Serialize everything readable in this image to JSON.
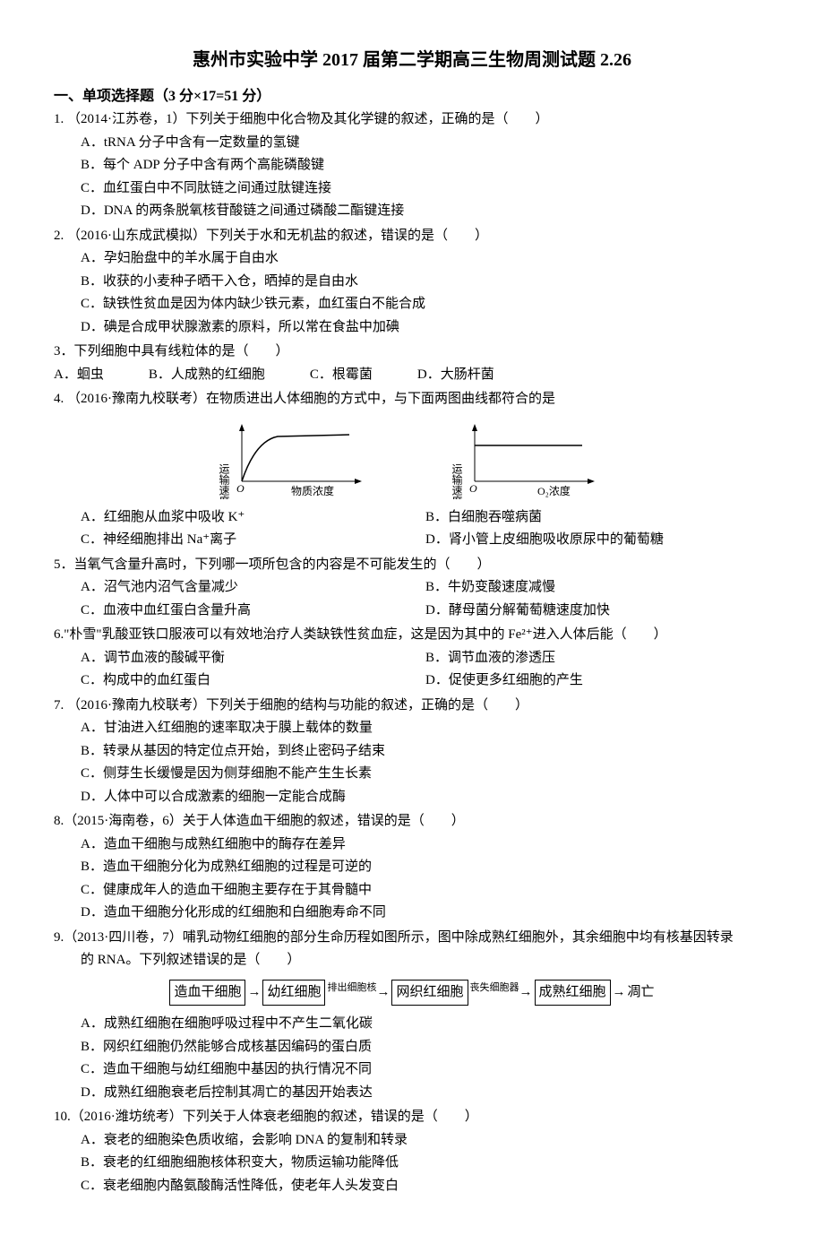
{
  "title": "惠州市实验中学 2017 届第二学期高三生物周测试题 2.26",
  "section1_header": "一、单项选择题（3 分×17=51 分）",
  "q1": {
    "stem": "1. （2014·江苏卷，1）下列关于细胞中化合物及其化学键的叙述，正确的是（　　）",
    "a": "A．tRNA 分子中含有一定数量的氢键",
    "b": "B．每个 ADP 分子中含有两个高能磷酸键",
    "c": "C．血红蛋白中不同肽链之间通过肽键连接",
    "d": "D．DNA 的两条脱氧核苷酸链之间通过磷酸二酯键连接"
  },
  "q2": {
    "stem": "2. （2016·山东成武模拟）下列关于水和无机盐的叙述，错误的是（　　）",
    "a": "A．孕妇胎盘中的羊水属于自由水",
    "b": "B．收获的小麦种子晒干入仓，晒掉的是自由水",
    "c": "C．缺铁性贫血是因为体内缺少铁元素，血红蛋白不能合成",
    "d": "D．碘是合成甲状腺激素的原料，所以常在食盐中加碘"
  },
  "q3": {
    "stem": "3．下列细胞中具有线粒体的是（　　）",
    "a": "A．蛔虫",
    "b": "B．人成熟的红细胞",
    "c": "C．根霉菌",
    "d": "D．大肠杆菌"
  },
  "q4": {
    "stem": "4. （2016·豫南九校联考）在物质进出人体细胞的方式中，与下面两图曲线都符合的是",
    "a": "A．红细胞从血浆中吸收 K⁺",
    "b": "B．白细胞吞噬病菌",
    "c": "C．神经细胞排出 Na⁺离子",
    "d": "D．肾小管上皮细胞吸收原尿中的葡萄糖"
  },
  "chart_data": [
    {
      "type": "line",
      "title": "",
      "xlabel": "物质浓度",
      "ylabel": "运输速度",
      "description": "saturation curve rising then plateau",
      "origin": "O"
    },
    {
      "type": "line",
      "title": "",
      "xlabel": "O₂浓度",
      "ylabel": "运输速度",
      "description": "horizontal line, constant rate independent of O2",
      "origin": "O"
    }
  ],
  "chart_labels": {
    "ylabel1": "运输速度",
    "xlabel1": "物质浓度",
    "origin1": "O",
    "ylabel2": "运输速度",
    "xlabel2": "O₂浓度",
    "origin2": "O"
  },
  "q5": {
    "stem": "5．当氧气含量升高时，下列哪一项所包含的内容是不可能发生的（　　）",
    "a": "A．沼气池内沼气含量减少",
    "b": "B．牛奶变酸速度减慢",
    "c": "C．血液中血红蛋白含量升高",
    "d": "D．酵母菌分解葡萄糖速度加快"
  },
  "q6": {
    "stem": "6.\"朴雪\"乳酸亚铁口服液可以有效地治疗人类缺铁性贫血症，这是因为其中的 Fe²⁺进入人体后能（　　）",
    "a": "A．调节血液的酸碱平衡",
    "b": "B．调节血液的渗透压",
    "c": "C．构成中的血红蛋白",
    "d": "D．促使更多红细胞的产生"
  },
  "q7": {
    "stem": "7. （2016·豫南九校联考）下列关于细胞的结构与功能的叙述，正确的是（　　）",
    "a": "A．甘油进入红细胞的速率取决于膜上载体的数量",
    "b": "B．转录从基因的特定位点开始，到终止密码子结束",
    "c": "C．侧芽生长缓慢是因为侧芽细胞不能产生生长素",
    "d": "D．人体中可以合成激素的细胞一定能合成酶"
  },
  "q8": {
    "stem": "8.（2015·海南卷，6）关于人体造血干细胞的叙述，错误的是（　　）",
    "a": "A．造血干细胞与成熟红细胞中的酶存在差异",
    "b": "B．造血干细胞分化为成熟红细胞的过程是可逆的",
    "c": "C．健康成年人的造血干细胞主要存在于其骨髓中",
    "d": "D．造血干细胞分化形成的红细胞和白细胞寿命不同"
  },
  "q9": {
    "stem_part1": "9.（2013·四川卷，7）哺乳动物红细胞的部分生命历程如图所示，图中除成熟红细胞外，其余细胞中均有核基因转录",
    "stem_part2": "的 RNA。下列叙述错误的是（　　）",
    "a": "A．成熟红细胞在细胞呼吸过程中不产生二氧化碳",
    "b": "B．网织红细胞仍然能够合成核基因编码的蛋白质",
    "c": "C．造血干细胞与幼红细胞中基因的执行情况不同",
    "d": "D．成熟红细胞衰老后控制其凋亡的基因开始表达"
  },
  "flow": {
    "box1": "造血干细胞",
    "box2": "幼红细胞",
    "label1": "排出细胞核",
    "box3": "网织红细胞",
    "label2": "丧失细胞器",
    "box4": "成熟红细胞",
    "end": "凋亡",
    "arrow": "→"
  },
  "q10": {
    "stem": "10.（2016·潍坊统考）下列关于人体衰老细胞的叙述，错误的是（　　）",
    "a": "A．衰老的细胞染色质收缩，会影响 DNA 的复制和转录",
    "b": "B．衰老的红细胞细胞核体积变大，物质运输功能降低",
    "c": "C．衰老细胞内酪氨酸酶活性降低，使老年人头发变白"
  }
}
